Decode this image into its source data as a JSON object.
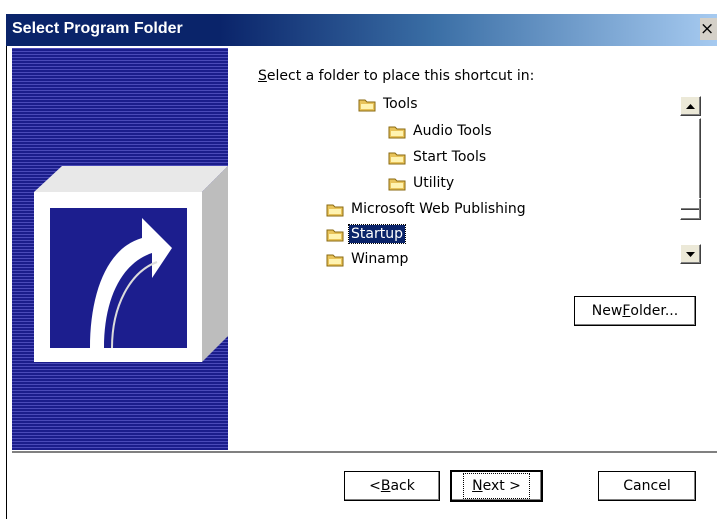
{
  "window": {
    "title": "Select Program Folder",
    "close_glyph": "×"
  },
  "prompt": {
    "prefix": "",
    "accel": "S",
    "rest": "elect a folder to place this shortcut in:"
  },
  "tree": {
    "items": [
      {
        "label": "Tools",
        "icon": "folder-icon",
        "selected": false
      },
      {
        "label": "Audio Tools",
        "icon": "folder-icon",
        "selected": false
      },
      {
        "label": "Start Tools",
        "icon": "folder-icon",
        "selected": false
      },
      {
        "label": "Utility",
        "icon": "folder-icon",
        "selected": false
      },
      {
        "label": "Microsoft Web Publishing",
        "icon": "folder-icon",
        "selected": false
      },
      {
        "label": "Startup",
        "icon": "folder-icon",
        "selected": true
      },
      {
        "label": "Winamp",
        "icon": "folder-icon",
        "selected": false
      }
    ]
  },
  "buttons": {
    "new_folder": {
      "pre": "New ",
      "accel": "F",
      "post": "older..."
    },
    "back": {
      "pre": "< ",
      "accel": "B",
      "post": "ack"
    },
    "next": {
      "pre": "",
      "accel": "N",
      "post": "ext >"
    },
    "cancel": {
      "label": "Cancel"
    }
  },
  "colors": {
    "title_bar": "#0a246a",
    "selection": "#0a246a",
    "banner": "#1c1e8e",
    "folder": "#e8c35a"
  }
}
